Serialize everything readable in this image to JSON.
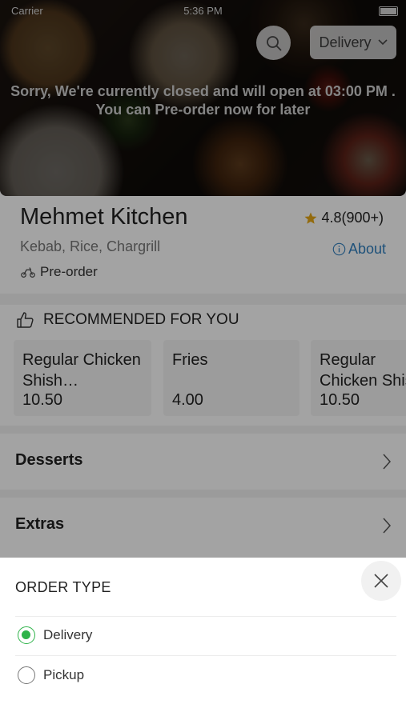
{
  "status_bar": {
    "carrier": "Carrier",
    "time": "5:36 PM"
  },
  "header": {
    "search_icon": "search-icon",
    "delivery_dropdown_label": "Delivery",
    "closed_message_line1": "Sorry, We're currently closed and will open at 03:00 PM .",
    "closed_message_line2": "You can Pre-order now for later"
  },
  "restaurant": {
    "name": "Mehmet Kitchen",
    "rating": "4.8(900+)",
    "cuisines": "Kebab, Rice, Chargrill",
    "about_label": "About",
    "preorder_label": "Pre-order"
  },
  "recommended": {
    "heading": "RECOMMENDED FOR YOU",
    "items": [
      {
        "name": "Regular Chicken Shish…",
        "price": "10.50"
      },
      {
        "name": "Fries",
        "price": "4.00"
      },
      {
        "name": "Regular Chicken Shish",
        "price": "10.50"
      }
    ]
  },
  "categories": [
    {
      "label": "Desserts"
    },
    {
      "label": "Extras"
    }
  ],
  "order_type": {
    "title": "ORDER TYPE",
    "options": [
      {
        "label": "Delivery",
        "selected": true
      },
      {
        "label": "Pickup",
        "selected": false
      }
    ]
  },
  "colors": {
    "accent_green": "#2fb34a",
    "link_blue": "#2f7fbf",
    "star": "#e6a817"
  }
}
